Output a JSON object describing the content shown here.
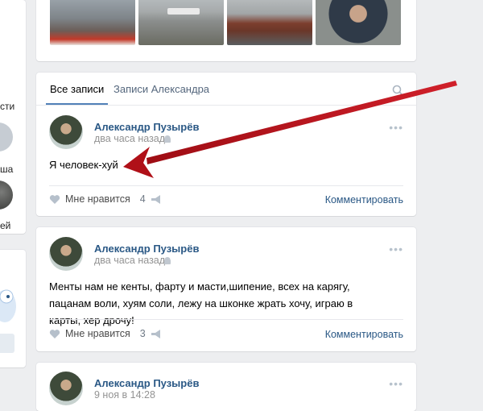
{
  "photos": [
    {
      "name": "photo-ferry-deck"
    },
    {
      "name": "photo-boat-on-river"
    },
    {
      "name": "photo-barges"
    },
    {
      "name": "photo-person-portrait"
    }
  ],
  "sidebar": {
    "partial_text_1": "сти",
    "partial_text_2": "ша",
    "partial_text_3": "ей"
  },
  "wall": {
    "tabs": [
      {
        "label": "Все записи",
        "active": true
      },
      {
        "label": "Записи Александра",
        "active": false
      }
    ],
    "search_icon": "search-icon"
  },
  "posts": [
    {
      "author": "Александр Пузырёв",
      "time": "два часа назад",
      "text": "Я человек-хуй",
      "like_label": "Мне нравится",
      "like_count": "4",
      "comment_label": "Комментировать",
      "more": "•••"
    },
    {
      "author": "Александр Пузырёв",
      "time": "два часа назад",
      "text": "Менты нам не кенты, фарту и масти,шипение, всех на карягу, пацанам воли, хуям соли, лежу на шконке жрать хочу, играю в карты, хер дрочу!",
      "like_label": "Мне нравится",
      "like_count": "3",
      "comment_label": "Комментировать",
      "more": "•••"
    },
    {
      "author": "Александр Пузырёв",
      "time": "9 ноя в 14:28",
      "more": "•••"
    }
  ],
  "colors": {
    "arrow": "#c0121a",
    "link": "#2a5885",
    "accent": "#5181b8"
  }
}
